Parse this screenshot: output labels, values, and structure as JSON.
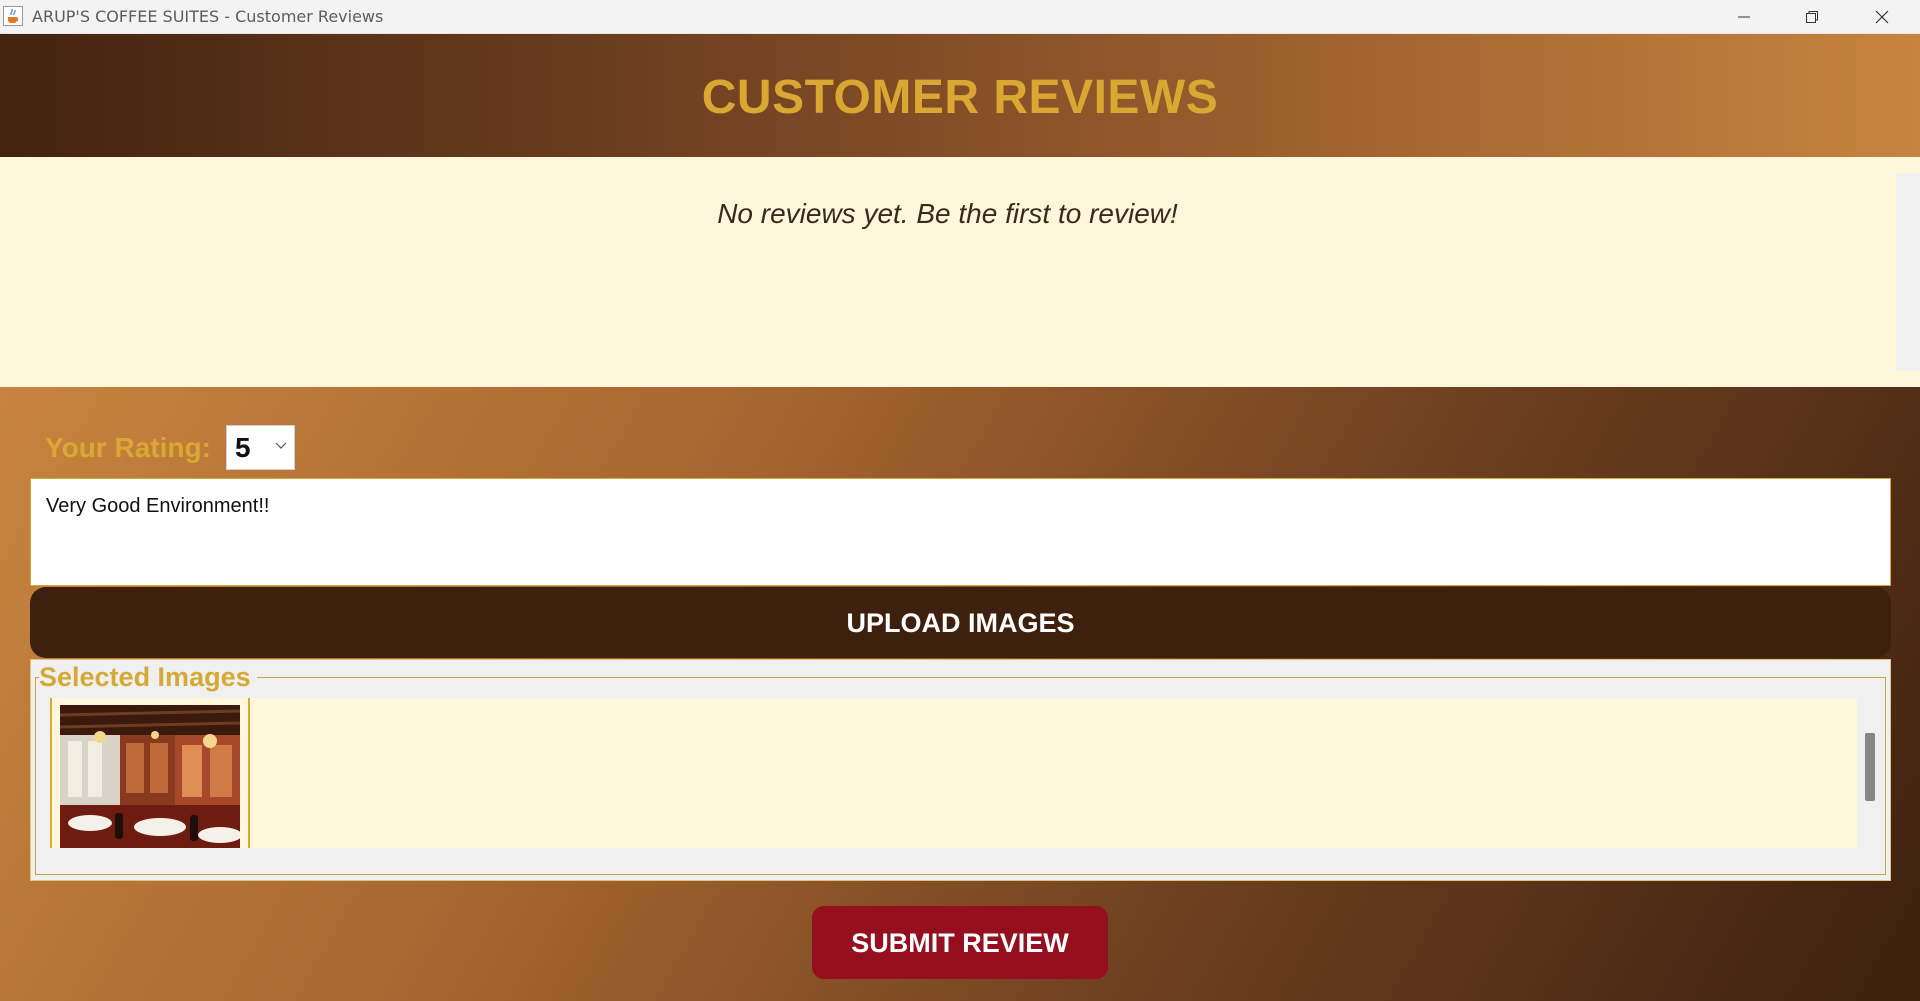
{
  "window": {
    "title": "ARUP'S COFFEE SUITES - Customer Reviews",
    "icon": "java-cup-icon",
    "controls": [
      "minimize-icon",
      "restore-icon",
      "close-icon"
    ]
  },
  "header": {
    "title": "CUSTOMER REVIEWS"
  },
  "reviews": {
    "empty_message": "No reviews yet. Be the first to review!"
  },
  "form": {
    "rating_label": "Your Rating:",
    "rating_value": "5",
    "review_text": "Very Good Environment!!",
    "upload_label": "UPLOAD IMAGES",
    "selected_images_legend": "Selected Images",
    "selected_images_count": 1,
    "submit_label": "SUBMIT REVIEW"
  },
  "colors": {
    "accent_gold": "#d9a832",
    "dark_brown": "#3e200e",
    "light_cream": "#fff7dc",
    "submit_red": "#960f1e",
    "header_gradient": [
      "#43230f",
      "#c7843f"
    ]
  }
}
